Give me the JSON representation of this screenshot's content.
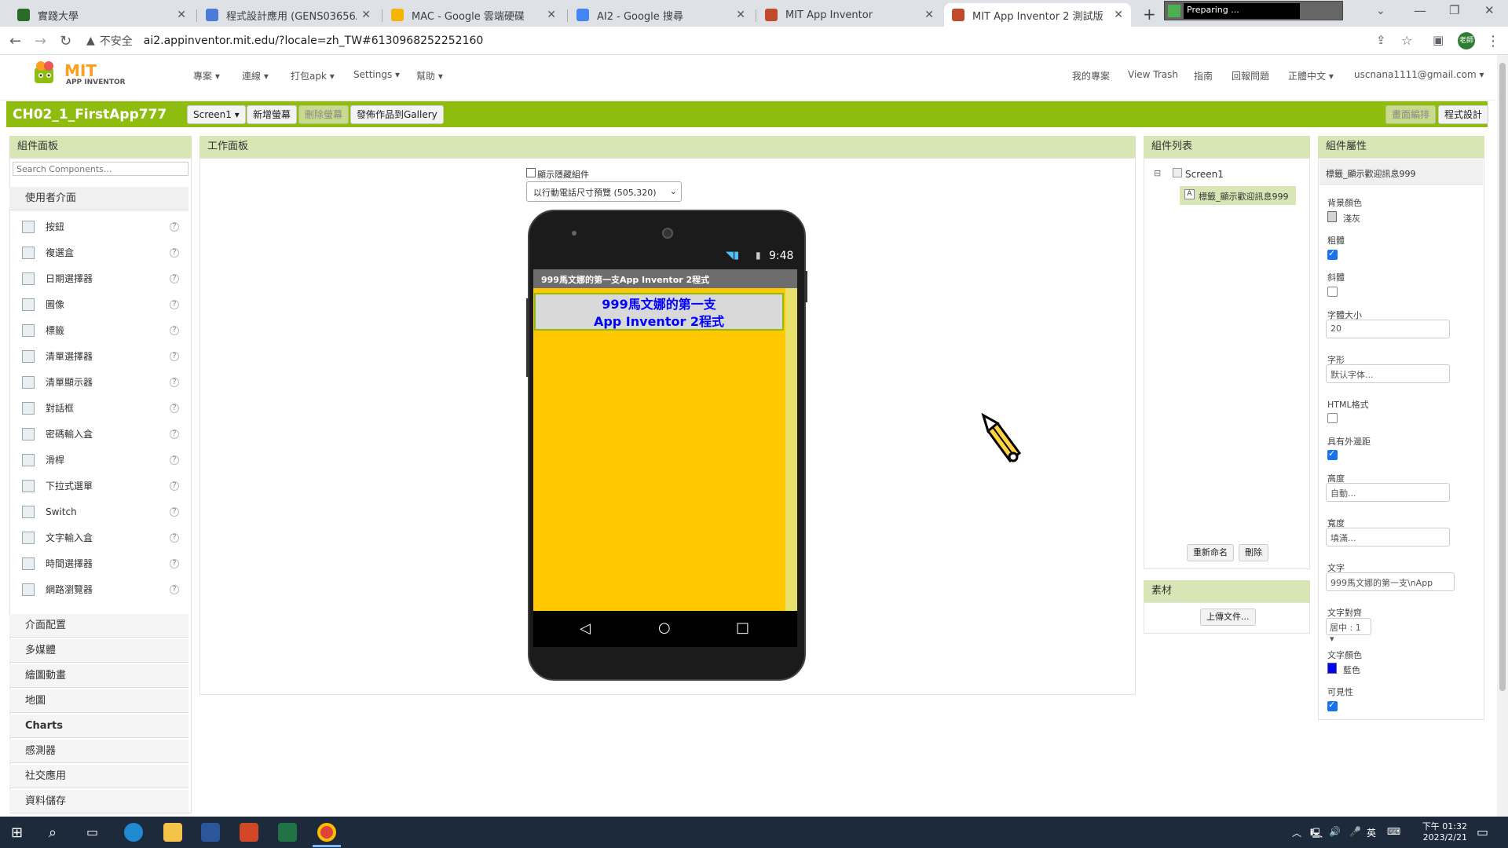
{
  "browser": {
    "tabs": [
      {
        "title": "實踐大學",
        "color": "#2a6b2a",
        "active": false
      },
      {
        "title": "程式設計應用 (GENS03656A1)",
        "color": "#4a7bd6",
        "active": false
      },
      {
        "title": "MAC - Google 雲端硬碟",
        "color": "#f4b400",
        "active": false
      },
      {
        "title": "AI2 - Google 搜尋",
        "color": "#4285f4",
        "active": false
      },
      {
        "title": "MIT App Inventor",
        "color": "#c04a2a",
        "active": false
      },
      {
        "title": "MIT App Inventor 2 測試版",
        "color": "#c04a2a",
        "active": true
      }
    ],
    "new_tab": "+",
    "extension_label": "Preparing ...",
    "not_secure": "不安全",
    "url": "ai2.appinventor.mit.edu/?locale=zh_TW#6130968252252160",
    "profile_badge": "老師"
  },
  "app": {
    "logo_mit": "MIT",
    "logo_sub": "APP INVENTOR",
    "menus": [
      "專案 ▾",
      "連線 ▾",
      "打包apk ▾",
      "Settings ▾",
      "幫助 ▾"
    ],
    "right_menus": [
      "我的專案",
      "View Trash",
      "指南",
      "回報問題",
      "正體中文 ▾",
      "uscnana1111@gmail.com ▾"
    ],
    "project_name": "CH02_1_FirstApp777",
    "screen_select": "Screen1 ▾",
    "add_screen": "新增螢幕",
    "remove_screen": "刪除螢幕",
    "publish_gallery": "發佈作品到Gallery",
    "designer_btn": "畫面編排",
    "blocks_btn": "程式設計"
  },
  "palette": {
    "title": "組件面板",
    "search_placeholder": "Search Components...",
    "category_open": "使用者介面",
    "components": [
      "按鈕",
      "複選盒",
      "日期選擇器",
      "圖像",
      "標籤",
      "清單選擇器",
      "清單顯示器",
      "對話框",
      "密碼輸入盒",
      "滑桿",
      "下拉式選單",
      "Switch",
      "文字輸入盒",
      "時間選擇器",
      "網路瀏覽器"
    ],
    "categories": [
      "介面配置",
      "多媒體",
      "繪圖動畫",
      "地圖",
      "Charts",
      "感測器",
      "社交應用",
      "資料儲存"
    ]
  },
  "viewer": {
    "title": "工作面板",
    "show_hidden": "顯示隱藏組件",
    "preview_size": "以行動電話尺寸預覽 (505,320)",
    "status_time": "9:48",
    "screen_title": "999馬文娜的第一支App Inventor 2程式",
    "label_line1": "999馬文娜的第一支",
    "label_line2": "App Inventor 2程式",
    "screen_bg": "#ffc800",
    "label_bg": "#d9d9d9",
    "label_color": "#0000ff"
  },
  "tree": {
    "title": "組件列表",
    "root": "Screen1",
    "child": "標籤_顯示歡迎訊息999",
    "rename": "重新命名",
    "delete": "刪除",
    "media_title": "素材",
    "upload": "上傳文件..."
  },
  "properties": {
    "title": "組件屬性",
    "component": "標籤_顯示歡迎訊息999",
    "bg_label": "背景顏色",
    "bg_value": "淺灰",
    "bold_label": "粗體",
    "italic_label": "斜體",
    "fontsize_label": "字體大小",
    "fontsize_value": "20",
    "typeface_label": "字形",
    "typeface_value": "默认字体...",
    "html_label": "HTML格式",
    "margins_label": "具有外邊距",
    "height_label": "高度",
    "height_value": "自動...",
    "width_label": "寬度",
    "width_value": "填滿...",
    "text_label": "文字",
    "text_value": "999馬文娜的第一支\\nApp",
    "align_label": "文字對齊",
    "align_value": "居中 : 1 ▾",
    "textcolor_label": "文字顏色",
    "textcolor_value": "藍色",
    "visible_label": "可見性"
  },
  "taskbar": {
    "time": "下午 01:32",
    "date": "2023/2/21",
    "ime": "英"
  }
}
